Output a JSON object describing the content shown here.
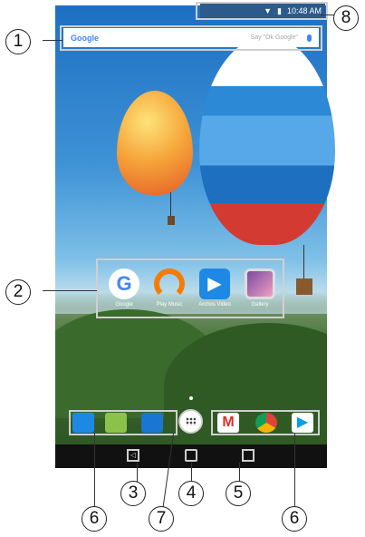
{
  "status_bar": {
    "time": "10:48 AM"
  },
  "search_bar": {
    "logo": "Google",
    "hint": "Say \"Ok Google\""
  },
  "home_apps": [
    {
      "label": "Google",
      "icon": "google-icon",
      "color": "#ffffff"
    },
    {
      "label": "Play Music",
      "icon": "headphones-icon",
      "color": "#f57c00"
    },
    {
      "label": "Archos Video",
      "icon": "video-play-icon",
      "color": "#1e88e5"
    },
    {
      "label": "Gallery",
      "icon": "gallery-icon",
      "color": "#4a3a6a"
    }
  ],
  "dock_left": [
    {
      "icon": "phone-icon",
      "color": "#1e88e5"
    },
    {
      "icon": "messaging-icon",
      "color": "#8bc34a"
    },
    {
      "icon": "contacts-icon",
      "color": "#1976d2"
    }
  ],
  "dock_right": [
    {
      "icon": "gmail-icon",
      "color": "#ffffff"
    },
    {
      "icon": "chrome-icon",
      "color": "#ffffff"
    },
    {
      "icon": "play-store-icon",
      "color": "#ffffff"
    }
  ],
  "callouts": [
    "1",
    "2",
    "3",
    "4",
    "5",
    "6",
    "6",
    "7",
    "8"
  ]
}
